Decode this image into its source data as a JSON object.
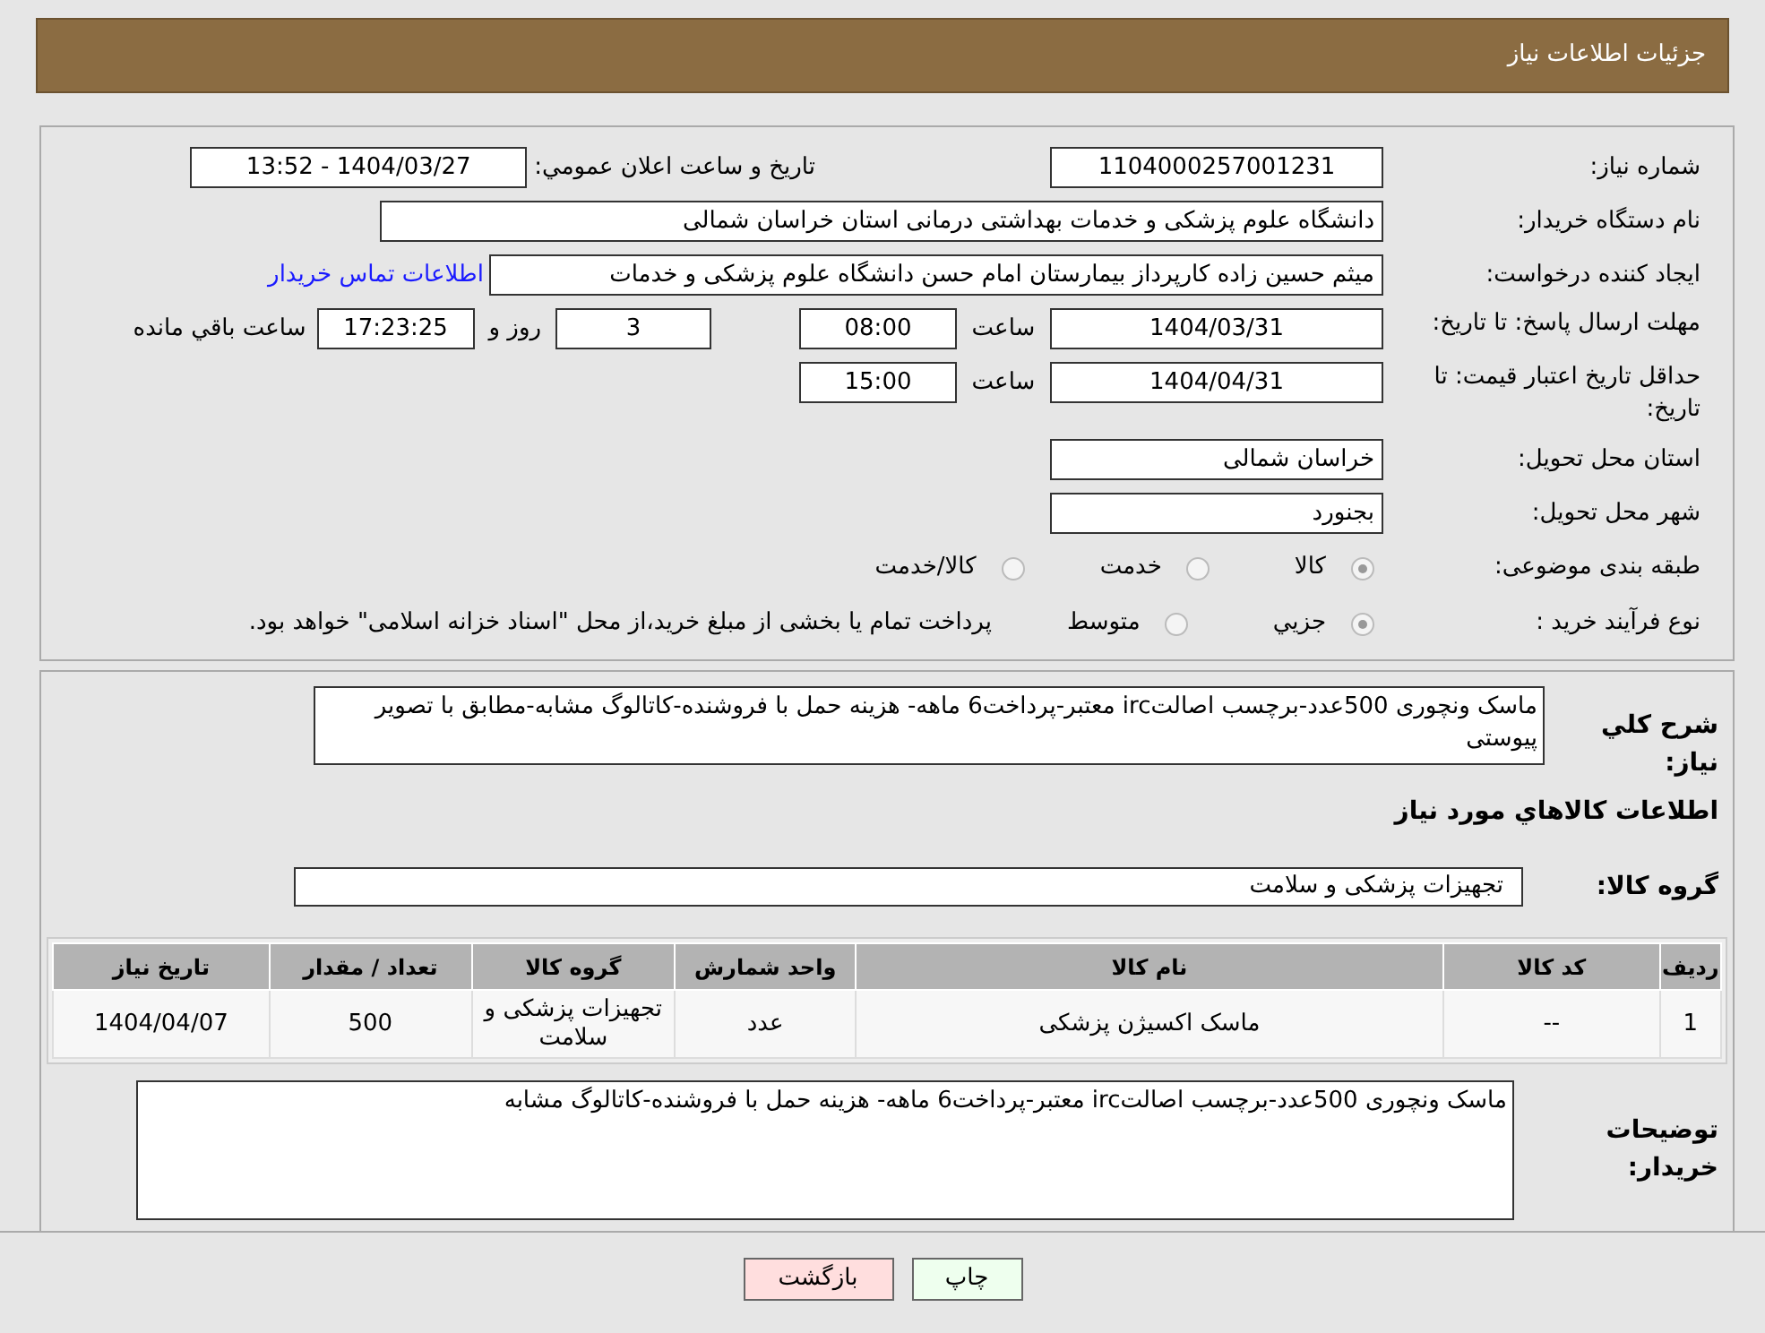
{
  "header": {
    "title": "جزئیات اطلاعات نیاز"
  },
  "need_number": {
    "label": "شماره نیاز:",
    "value": "1104000257001231"
  },
  "announce": {
    "label": "تاریخ و ساعت اعلان عمومي:",
    "value": "1404/03/27 - 13:52"
  },
  "buyer_org": {
    "label": "نام دستگاه خریدار:",
    "value": "دانشگاه علوم پزشکی و خدمات بهداشتی درمانی استان خراسان شمالی"
  },
  "requester": {
    "label": "ایجاد کننده درخواست:",
    "value": "میثم  حسین زاده  کارپرداز بیمارستان امام حسن دانشگاه علوم پزشکی و خدمات",
    "contact_link": "اطلاعات تماس خریدار"
  },
  "reply_deadline": {
    "label": "مهلت ارسال پاسخ: تا تاریخ:",
    "date": "1404/03/31",
    "time_label": "ساعت",
    "time": "08:00",
    "days": "3",
    "days_label": "روز و",
    "remaining": "17:23:25",
    "remaining_label": "ساعت باقي مانده"
  },
  "price_validity": {
    "label": "حداقل تاریخ اعتبار قیمت: تا تاریخ:",
    "date": "1404/04/31",
    "time_label": "ساعت",
    "time": "15:00"
  },
  "province": {
    "label": "استان محل تحویل:",
    "value": "خراسان شمالی"
  },
  "city": {
    "label": "شهر محل تحویل:",
    "value": "بجنورد"
  },
  "category": {
    "label": "طبقه بندی موضوعی:",
    "options": [
      {
        "label": "کالا",
        "selected": true
      },
      {
        "label": "خدمت",
        "selected": false
      },
      {
        "label": "کالا/خدمت",
        "selected": false
      }
    ]
  },
  "purchase_type": {
    "label": "نوع فرآیند خرید :",
    "options": [
      {
        "label": "جزيي",
        "selected": true
      },
      {
        "label": "متوسط",
        "selected": false
      }
    ],
    "note": "پرداخت تمام یا بخشی از مبلغ خرید،از محل \"اسناد خزانه اسلامی\" خواهد بود."
  },
  "description": {
    "label": "شرح کلي نیاز:",
    "value": "ماسک ونچوری 500عدد-برچسب اصالتirc معتبر-پرداخت6 ماهه- هزینه حمل با فروشنده-کاتالوگ مشابه-مطابق با تصویر پیوستی"
  },
  "goods_heading": "اطلاعات کالاهاي مورد نیاز",
  "goods_group": {
    "label": "گروه کالا:",
    "value": "تجهیزات پزشکی و سلامت"
  },
  "table": {
    "columns": [
      "ردیف",
      "کد کالا",
      "نام کالا",
      "واحد شمارش",
      "گروه کالا",
      "تعداد / مقدار",
      "تاریخ نیاز"
    ],
    "rows": [
      [
        "1",
        "--",
        "ماسک اکسیژن پزشکی",
        "عدد",
        "تجهیزات پزشکی و سلامت",
        "500",
        "1404/04/07"
      ]
    ]
  },
  "buyer_notes": {
    "label": "توضیحات خریدار:",
    "value": "ماسک ونچوری 500عدد-برچسب اصالتirc معتبر-پرداخت6 ماهه- هزینه حمل با فروشنده-کاتالوگ مشابه"
  },
  "buttons": [
    {
      "label": "چاپ",
      "kind": "print"
    },
    {
      "label": "بازگشت",
      "kind": "back"
    }
  ]
}
